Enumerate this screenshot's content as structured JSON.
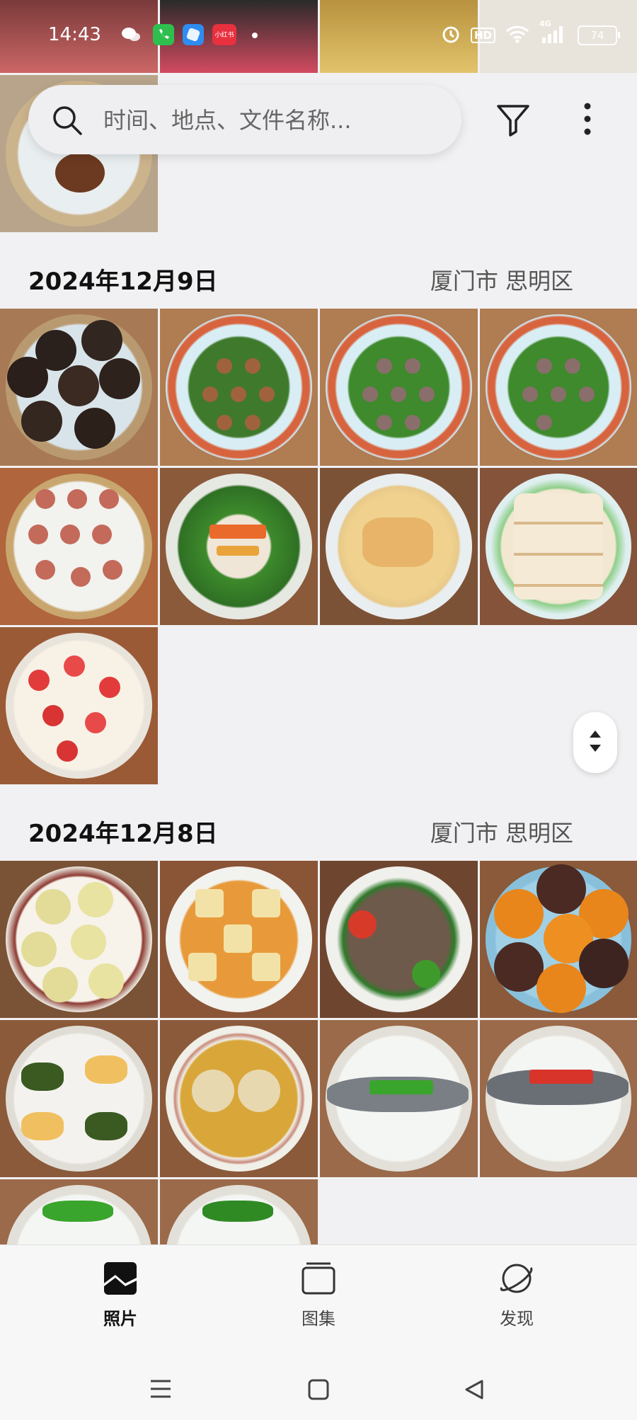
{
  "status_bar": {
    "time": "14:43",
    "app_badge": "小红书",
    "network": "4G",
    "hd": "HD",
    "battery": "74"
  },
  "search": {
    "placeholder": "时间、地点、文件名称..."
  },
  "sections": [
    {
      "date": "2024年12月9日",
      "location": "厦门市 思明区"
    },
    {
      "date": "2024年12月8日",
      "location": "厦门市 思明区"
    }
  ],
  "bottom_nav": {
    "tabs": [
      {
        "label": "照片",
        "active": true
      },
      {
        "label": "图集",
        "active": false
      },
      {
        "label": "发现",
        "active": false
      }
    ]
  },
  "colors": {
    "accent": "#111111",
    "background": "#f1f1f3"
  }
}
